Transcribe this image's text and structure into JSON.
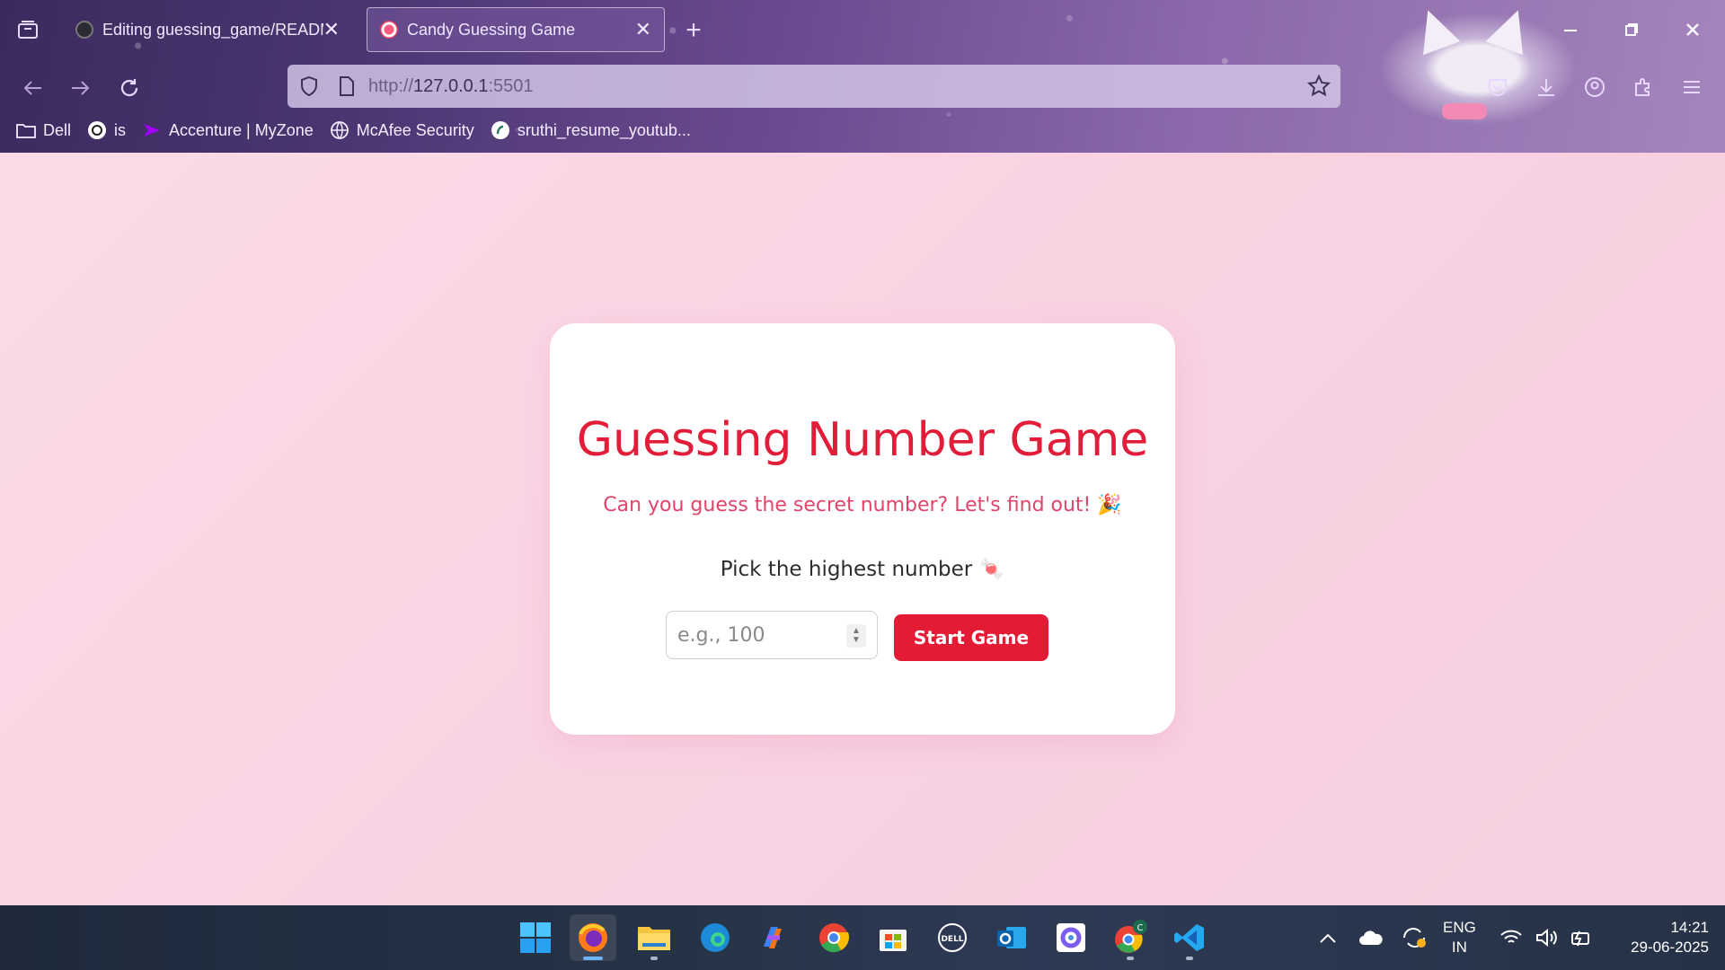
{
  "browser": {
    "tabs": [
      {
        "title": "Editing guessing_game/READM",
        "active": false
      },
      {
        "title": "Candy Guessing Game",
        "active": true
      }
    ],
    "new_tab_label": "+",
    "address": {
      "prefix": "http://",
      "host": "127.0.0.1",
      "port": ":5501"
    },
    "bookmarks": [
      {
        "label": "Dell",
        "icon": "folder-icon"
      },
      {
        "label": "is",
        "icon": "chatgpt-icon"
      },
      {
        "label": "Accenture | MyZone",
        "icon": "accenture-icon"
      },
      {
        "label": "McAfee Security",
        "icon": "globe-icon"
      },
      {
        "label": "sruthi_resume_youtub...",
        "icon": "link-icon"
      }
    ]
  },
  "game": {
    "title": "Guessing Number Game",
    "subtitle": "Can you guess the secret number? Let's find out! 🎉",
    "prompt": "Pick the highest number 🍬",
    "input_placeholder": "e.g., 100",
    "input_value": "",
    "start_label": "Start Game"
  },
  "taskbar": {
    "apps": [
      "windows-start",
      "firefox",
      "file-explorer",
      "edge",
      "copilot",
      "chrome",
      "microsoft-store",
      "dell",
      "outlook",
      "power-automate",
      "chrome-profile",
      "vscode"
    ],
    "lang_primary": "ENG",
    "lang_secondary": "IN",
    "time": "14:21",
    "date": "29-06-2025"
  },
  "colors": {
    "accent": "#e41b35",
    "title": "#e11d3a",
    "subtitle": "#e0446a",
    "page_bg": "#f9d4e3"
  }
}
